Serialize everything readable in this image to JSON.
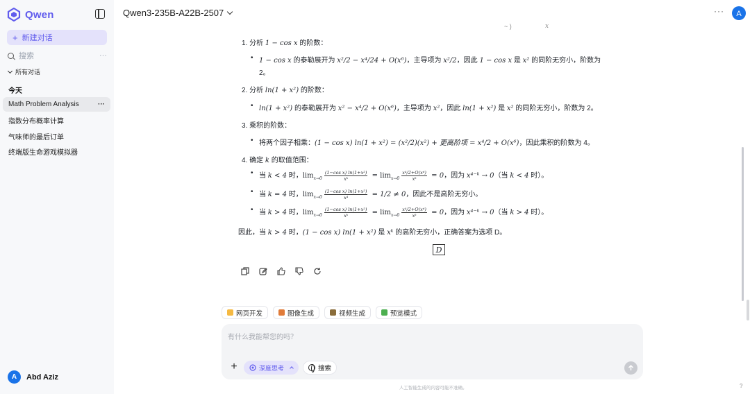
{
  "sidebar": {
    "logo_text": "Qwen",
    "new_chat_label": "新建对话",
    "search_placeholder": "搜索",
    "search_more": "···",
    "all_chats_label": "所有对话",
    "group_today": "今天",
    "items": [
      {
        "label": "Math Problem Analysis",
        "active": true,
        "more": "···"
      },
      {
        "label": "指数分布概率计算",
        "active": false
      },
      {
        "label": "气味师的最后订单",
        "active": false
      },
      {
        "label": "终端版生命游戏模拟器",
        "active": false
      }
    ],
    "user": {
      "initial": "A",
      "name": "Abd Aziz"
    }
  },
  "header": {
    "model_name": "Qwen3-235B-A22B-2507",
    "more": "···",
    "avatar_initial": "A",
    "accent": "#615ced",
    "avatar_color": "#1a73e8"
  },
  "answer": {
    "step1_title_pre": "1.  分析 ",
    "step1_title_math": "1 − cos x",
    "step1_title_post": " 的阶数：",
    "step1_b1_a": "1 − cos x",
    "step1_b1_b": " 的泰勒展开为 ",
    "step1_b1_c": "x²/2 − x⁴/24 + O(x⁶)",
    "step1_b1_d": "，主导项为 ",
    "step1_b1_e": "x²/2",
    "step1_b1_f": "，因此 ",
    "step1_b1_g": "1 − cos x",
    "step1_b1_h": " 是 ",
    "step1_b1_i": "x²",
    "step1_b1_j": " 的同阶无穷小，阶数为",
    "step1_b1_k": "2。",
    "step2_title_pre": "2.  分析 ",
    "step2_title_math": "ln(1 + x²)",
    "step2_title_post": " 的阶数：",
    "step2_b1_a": "ln(1 + x²)",
    "step2_b1_b": " 的泰勒展开为 ",
    "step2_b1_c": "x² − x⁴/2 + O(x⁶)",
    "step2_b1_d": "，主导项为 ",
    "step2_b1_e": "x²",
    "step2_b1_f": "，因此 ",
    "step2_b1_g": "ln(1 + x²)",
    "step2_b1_h": " 是 ",
    "step2_b1_i": "x²",
    "step2_b1_j": " 的同阶无穷小，阶数为 2。",
    "step3_title": "3.  乘积的阶数：",
    "step3_b1_a": "将两个因子相乘：",
    "step3_b1_b": "(1 − cos x) ln(1 + x²) = (x²/2)(x²) + 更高阶项 = x⁴/2 + O(x⁶)",
    "step3_b1_c": "，因此乘积的阶数为 4。",
    "step4_title_pre": "4.  确定 ",
    "step4_title_math": "k",
    "step4_title_post": " 的取值范围：",
    "case1_a": "当 ",
    "case1_b": "k < 4",
    "case1_c": " 时，",
    "case1_lim": "lim",
    "case1_sub": "x→0",
    "case1_num": "(1−cos x) ln(1+x²)",
    "case1_den": "xᵏ",
    "case1_eq": " = lim",
    "case1_sub2": "x→0",
    "case1_num2": "x⁴/2+O(x⁶)",
    "case1_den2": "xᵏ",
    "case1_res": " = 0",
    "case1_d": "，因为 ",
    "case1_e": "x⁴⁻ᵏ → 0",
    "case1_f": "（当 ",
    "case1_g": "k < 4",
    "case1_h": " 时）。",
    "case2_a": "当 ",
    "case2_b": "k = 4",
    "case2_c": " 时，",
    "case2_lim": "lim",
    "case2_sub": "x→0",
    "case2_num": "(1−cos x) ln(1+x²)",
    "case2_den": "x⁴",
    "case2_res": " = 1/2 ≠ 0",
    "case2_d": "，因此不是高阶无穷小。",
    "case3_a": "当 ",
    "case3_b": "k > 4",
    "case3_c": " 时，",
    "case3_lim": "lim",
    "case3_sub": "x→0",
    "case3_num": "(1−cos x) ln(1+x²)",
    "case3_den": "xᵏ",
    "case3_eq": " = lim",
    "case3_sub2": "x→0",
    "case3_num2": "x⁴/2+O(x⁶)",
    "case3_den2": "xᵏ",
    "case3_res": " = 0",
    "case3_d": "，因为 ",
    "case3_e": "x⁴⁻ᵏ → 0",
    "case3_f": "（当 ",
    "case3_g": "k > 4",
    "case3_h": " 时）。",
    "concl_a": "因此，当 ",
    "concl_b": "k > 4",
    "concl_c": " 时，",
    "concl_d": "(1 − cos x) ln(1 + x²)",
    "concl_e": " 是 ",
    "concl_f": "xᵏ",
    "concl_g": " 的高阶无穷小，正确答案为选项 D。",
    "boxed": "D",
    "top_fragment_1": "~ )",
    "top_fragment_2": "x"
  },
  "features": [
    {
      "label": "网页开发",
      "color": "#f5b942"
    },
    {
      "label": "图像生成",
      "color": "#e07b39"
    },
    {
      "label": "视频生成",
      "color": "#8a6d3b"
    },
    {
      "label": "预览模式",
      "color": "#4caf50"
    }
  ],
  "input": {
    "placeholder": "有什么我能帮您的吗？",
    "think_label": "深度思考",
    "search_label": "搜索",
    "disclaimer": "人工智能生成的内容可能不准确。",
    "help": "?"
  }
}
